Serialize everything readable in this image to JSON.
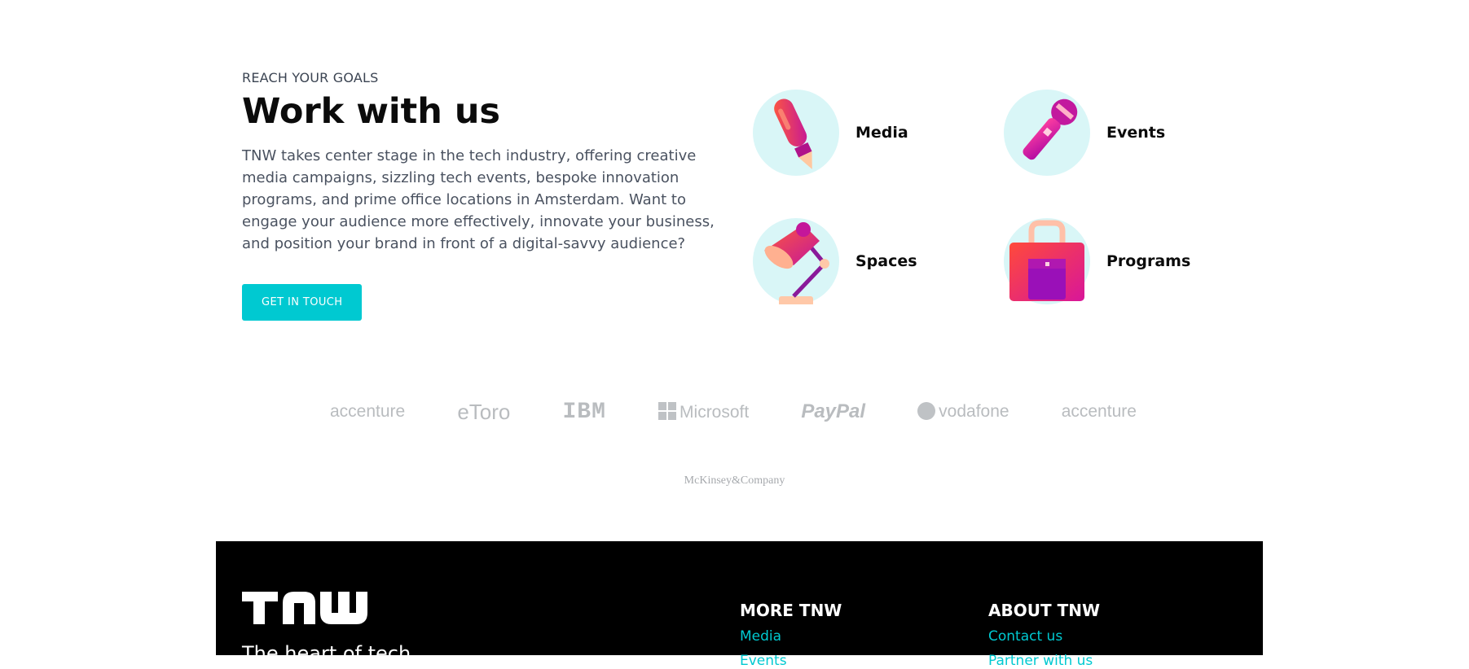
{
  "work": {
    "eyebrow": "REACH YOUR GOALS",
    "title": "Work with us",
    "description": "TNW takes center stage in the tech industry, offering creative media campaigns, sizzling tech events, bespoke innovation programs, and prime office locations in Amsterdam. Want to engage your audience more effectively, innovate your business, and position your brand in front of a digital-savvy audience?",
    "cta_label": "GET IN TOUCH"
  },
  "services": [
    {
      "label": "Media",
      "icon": "pen-icon"
    },
    {
      "label": "Events",
      "icon": "microphone-icon"
    },
    {
      "label": "Spaces",
      "icon": "desk-lamp-icon"
    },
    {
      "label": "Programs",
      "icon": "bag-icon"
    }
  ],
  "partners": {
    "logos": [
      "accenture",
      "eToro",
      "IBM",
      "Microsoft",
      "PayPal",
      "vodafone",
      "accenture"
    ],
    "second_row": "McKinsey&Company"
  },
  "footer": {
    "logo": "TNW",
    "tagline": "The heart of tech",
    "more_tnw": {
      "heading": "MORE TNW",
      "links": [
        "Media",
        "Events"
      ]
    },
    "about_tnw": {
      "heading": "ABOUT TNW",
      "links": [
        "Contact us",
        "Partner with us"
      ]
    }
  },
  "colors": {
    "accent": "#00c9d1",
    "icon_bg": "#d9f6f7",
    "footer_bg": "#000000",
    "logo_gray": "#b9bcbf"
  }
}
